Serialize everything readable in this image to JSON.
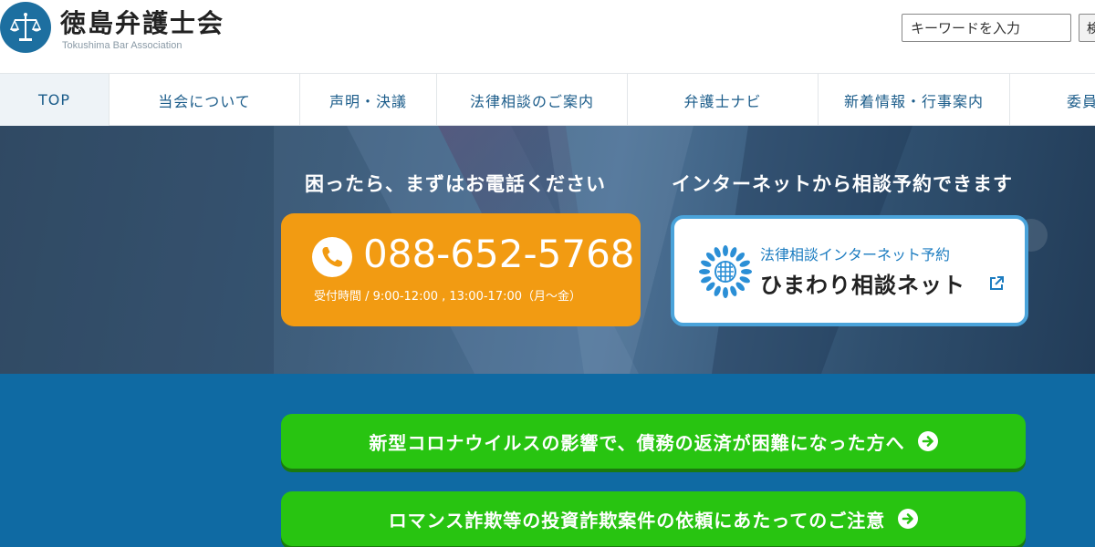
{
  "header": {
    "title": "徳島弁護士会",
    "subtitle": "Tokushima Bar Association",
    "search_placeholder": "キーワードを入力",
    "search_button_label": "検"
  },
  "nav": {
    "items": [
      {
        "label": "TOP"
      },
      {
        "label": "当会について"
      },
      {
        "label": "声明・決議"
      },
      {
        "label": "法律相談のご案内"
      },
      {
        "label": "弁護士ナビ"
      },
      {
        "label": "新着情報・行事案内"
      },
      {
        "label": "委員"
      }
    ]
  },
  "hero": {
    "phone_heading": "困ったら、まずはお電話ください",
    "phone_number": "088-652-5768",
    "phone_hours": "受付時間 / 9:00-12:00 , 13:00-17:00（月〜金）",
    "internet_heading": "インターネットから相談予約できます",
    "himawari_sub": "法律相談インターネット予約",
    "himawari_title": "ひまわり相談ネット"
  },
  "notices": [
    {
      "label": "新型コロナウイルスの影響で、債務の返済が困難になった方へ"
    },
    {
      "label": "ロマンス詐欺等の投資詐欺案件の依頼にあたってのご注意"
    }
  ],
  "colors": {
    "accent": "#1b5c8a",
    "phone_card": "#f29b12",
    "notice_green": "#28c411",
    "notice_bg": "#0f6aa3",
    "himawari_border": "#4aa3da"
  },
  "icons": {
    "logo": "scales-of-justice-icon",
    "phone": "phone-icon",
    "himawari": "sunflower-icon",
    "external": "external-link-icon",
    "arrow": "arrow-right-circle-icon"
  }
}
